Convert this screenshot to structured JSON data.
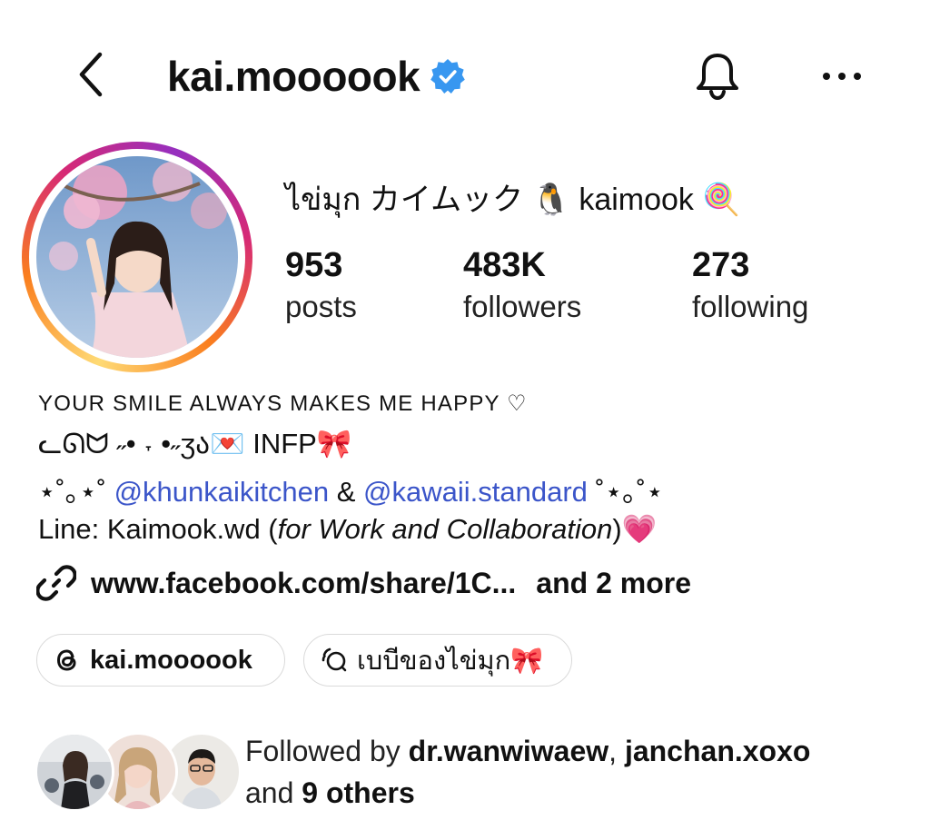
{
  "header": {
    "username": "kai.moooook",
    "verified_color": "#3897f0"
  },
  "profile": {
    "display_name": "ไข่มุก カイムック 🐧 kaimook 🍭",
    "stats": [
      {
        "value": "953",
        "label": "posts"
      },
      {
        "value": "483K",
        "label": "followers"
      },
      {
        "value": "273",
        "label": "following"
      }
    ]
  },
  "bio": {
    "line1": "YOUR SMILE ALWAYS MAKES ME HAPPY ♡",
    "line2": "ᓚᘏᗢ ˶•  ˕  •˶ʒა💌 INFP🎀",
    "line3_prefix": "⋆˚｡⋆˚ ",
    "mention1": "@khunkaikitchen",
    "line3_amp": " & ",
    "mention2": "@kawaii.standard",
    "line3_suffix": " ˚⋆｡˚⋆",
    "line4_prefix": "Line: Kaimook.wd (",
    "line4_italic": "for Work and Collaboration",
    "line4_suffix": ")💗"
  },
  "links": {
    "url": "www.facebook.com/share/1C...",
    "more": "and 2 more"
  },
  "chips": {
    "threads_label": "kai.moooook",
    "channel_label": "เบบีของไข่มุก🎀"
  },
  "followed_by": {
    "prefix": "Followed by ",
    "user1": "dr.wanwiwaew",
    "sep": ", ",
    "user2": "janchan.xoxo",
    "and": "and ",
    "others": "9 others"
  },
  "colors": {
    "mention": "#3b55c9",
    "verified": "#3897f0"
  },
  "icons": {
    "back": "chevron-left-icon",
    "bell": "bell-icon",
    "more": "more-horizontal-icon",
    "link": "link-icon",
    "threads": "threads-icon",
    "channel": "broadcast-channel-icon"
  }
}
